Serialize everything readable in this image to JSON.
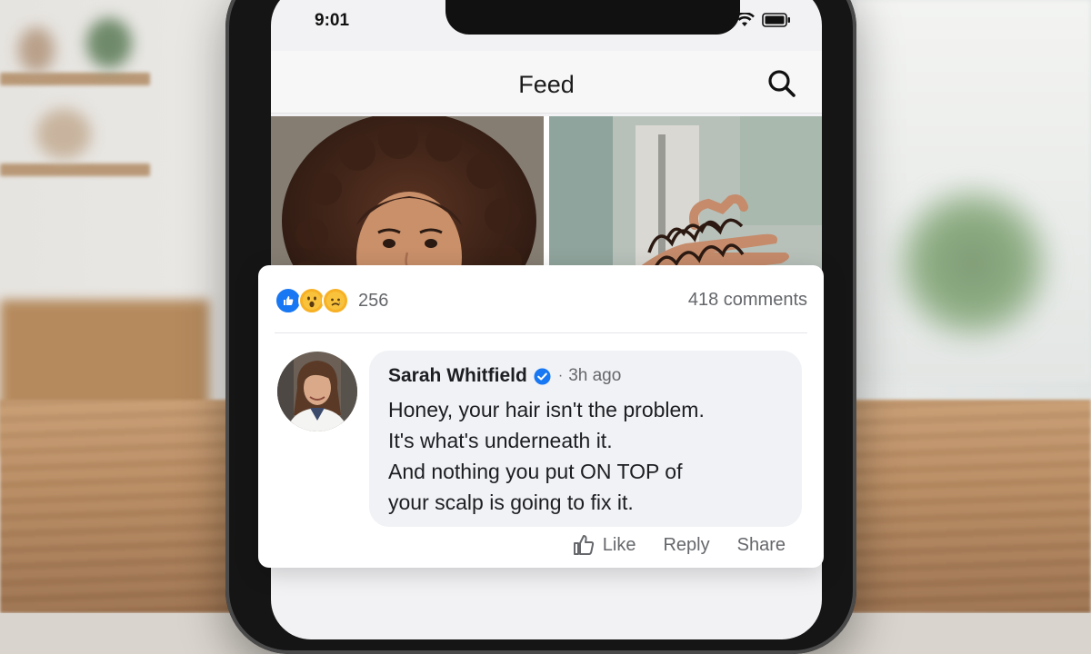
{
  "status_bar": {
    "time": "9:01"
  },
  "header": {
    "title": "Feed"
  },
  "post": {
    "reaction_count": "256",
    "comments_count": "418 comments",
    "reactions": [
      "like-icon",
      "wow-icon",
      "sad-icon"
    ]
  },
  "comment": {
    "author": "Sarah Whitfield",
    "separator": "·",
    "time": "3h ago",
    "lines": [
      "Honey, your hair isn't the problem.",
      "It's what's underneath it.",
      "And nothing you put ON TOP of",
      "your scalp is going to fix it."
    ]
  },
  "actions": {
    "like": "Like",
    "reply": "Reply",
    "share": "Share"
  },
  "colors": {
    "accent": "#1877f2",
    "meta": "#65676b",
    "bubble": "#f0f2f5"
  }
}
